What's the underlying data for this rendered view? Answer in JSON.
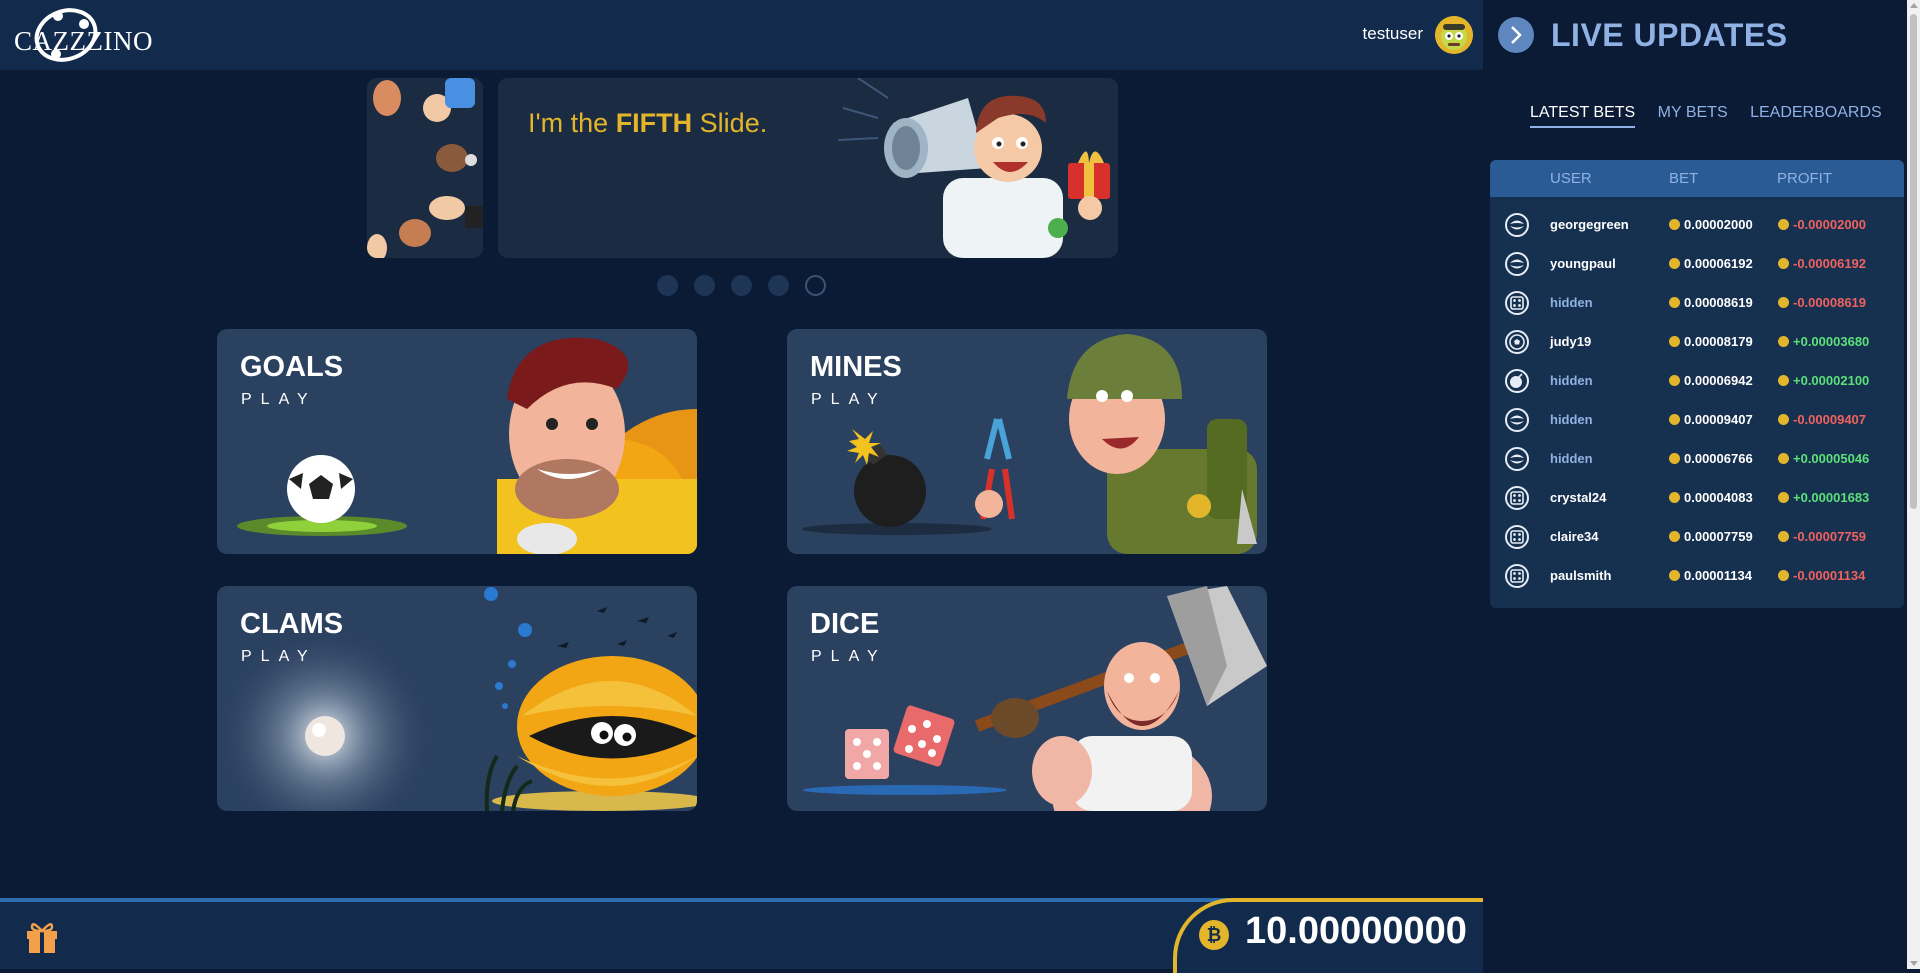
{
  "header": {
    "logo_text": "CAZZZINO",
    "username": "testuser"
  },
  "slider": {
    "text_prefix": "I'm the ",
    "text_bold": "FIFTH",
    "text_suffix": " Slide.",
    "slide_count": 5,
    "active_index": 5
  },
  "games": [
    {
      "title": "GOALS",
      "subtitle": "PLAY"
    },
    {
      "title": "MINES",
      "subtitle": "PLAY"
    },
    {
      "title": "CLAMS",
      "subtitle": "PLAY"
    },
    {
      "title": "DICE",
      "subtitle": "PLAY"
    }
  ],
  "footer": {
    "balance": "10.00000000",
    "currency_symbol": "₿"
  },
  "panel": {
    "title": "LIVE UPDATES",
    "tabs": [
      "LATEST BETS",
      "MY BETS",
      "LEADERBOARDS"
    ],
    "active_tab": "LATEST BETS",
    "columns": {
      "user": "USER",
      "bet": "BET",
      "profit": "PROFIT"
    },
    "rows": [
      {
        "game_icon": "clams-icon",
        "user": "georgegreen",
        "hidden": false,
        "bet": "0.00002000",
        "profit": "-0.00002000",
        "status": "loss"
      },
      {
        "game_icon": "clams-icon",
        "user": "youngpaul",
        "hidden": false,
        "bet": "0.00006192",
        "profit": "-0.00006192",
        "status": "loss"
      },
      {
        "game_icon": "dice-icon",
        "user": "hidden",
        "hidden": true,
        "bet": "0.00008619",
        "profit": "-0.00008619",
        "status": "loss"
      },
      {
        "game_icon": "goals-icon",
        "user": "judy19",
        "hidden": false,
        "bet": "0.00008179",
        "profit": "+0.00003680",
        "status": "win"
      },
      {
        "game_icon": "mines-icon",
        "user": "hidden",
        "hidden": true,
        "bet": "0.00006942",
        "profit": "+0.00002100",
        "status": "win"
      },
      {
        "game_icon": "clams-icon",
        "user": "hidden",
        "hidden": true,
        "bet": "0.00009407",
        "profit": "-0.00009407",
        "status": "loss"
      },
      {
        "game_icon": "clams-icon",
        "user": "hidden",
        "hidden": true,
        "bet": "0.00006766",
        "profit": "+0.00005046",
        "status": "win"
      },
      {
        "game_icon": "dice-icon",
        "user": "crystal24",
        "hidden": false,
        "bet": "0.00004083",
        "profit": "+0.00001683",
        "status": "win"
      },
      {
        "game_icon": "dice-icon",
        "user": "claire34",
        "hidden": false,
        "bet": "0.00007759",
        "profit": "-0.00007759",
        "status": "loss"
      },
      {
        "game_icon": "dice-icon",
        "user": "paulsmith",
        "hidden": false,
        "bet": "0.00001134",
        "profit": "-0.00001134",
        "status": "loss"
      }
    ]
  },
  "colors": {
    "background": "#0b1b35",
    "bar": "#122b4c",
    "accent_gold": "#e3b52b",
    "accent_blue": "#8fb1e3",
    "loss": "#f0625f",
    "win": "#5be07a"
  }
}
